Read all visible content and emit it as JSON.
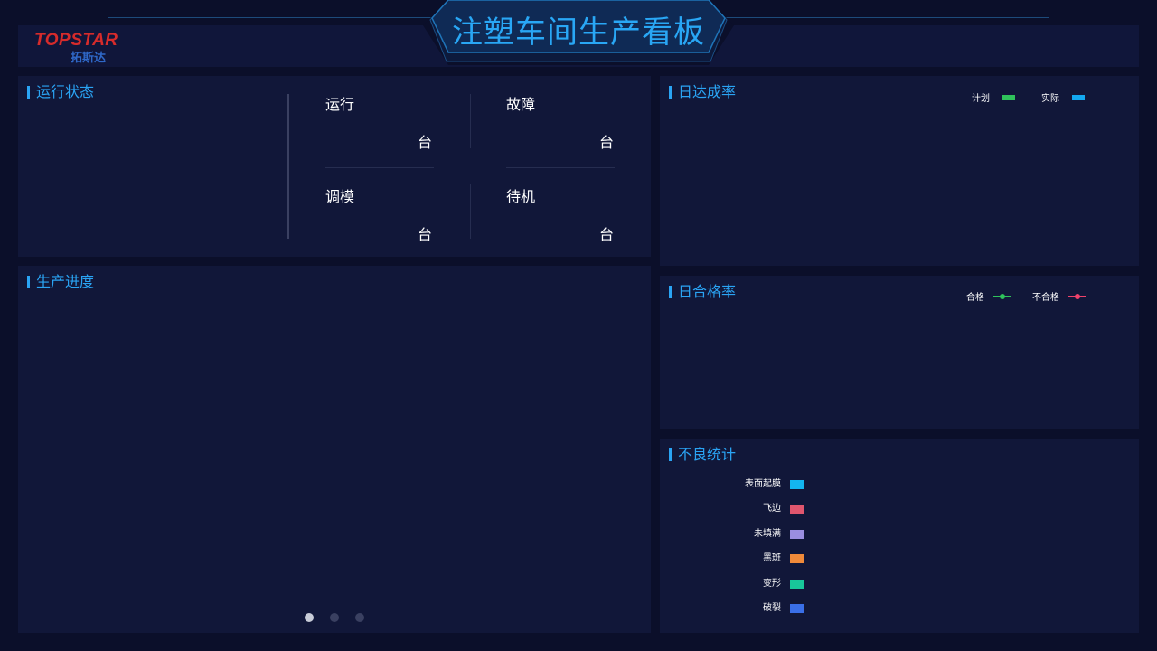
{
  "header": {
    "title": "注塑车间生产看板",
    "logo_text": "TOPSTAR",
    "logo_sub": "拓斯达"
  },
  "status_panel": {
    "title": "运行状态",
    "items": [
      {
        "label": "运行",
        "unit": "台"
      },
      {
        "label": "故障",
        "unit": "台"
      },
      {
        "label": "调模",
        "unit": "台"
      },
      {
        "label": "待机",
        "unit": "台"
      }
    ]
  },
  "progress_panel": {
    "title": "生产进度",
    "pages": 3,
    "active_page": 1
  },
  "daily_rate_panel": {
    "title": "日达成率",
    "legend": [
      {
        "label": "计划",
        "color": "#2fc25b"
      },
      {
        "label": "实际",
        "color": "#13a8f0"
      }
    ]
  },
  "quality_panel": {
    "title": "日合格率",
    "legend": [
      {
        "label": "合格",
        "color": "#2fc25b"
      },
      {
        "label": "不合格",
        "color": "#f0426b"
      }
    ]
  },
  "defect_panel": {
    "title": "不良统计",
    "legend": [
      {
        "label": "表面起膜",
        "color": "#13b5f0"
      },
      {
        "label": "飞边",
        "color": "#e0566e"
      },
      {
        "label": "未填满",
        "color": "#9a8ee0"
      },
      {
        "label": "黑斑",
        "color": "#f08a3a"
      },
      {
        "label": "变形",
        "color": "#18c79a"
      },
      {
        "label": "破裂",
        "color": "#3a6fe8"
      }
    ]
  },
  "colors": {
    "background": "#0b0f2a",
    "panel": "#111739",
    "accent": "#2aa4f4"
  }
}
